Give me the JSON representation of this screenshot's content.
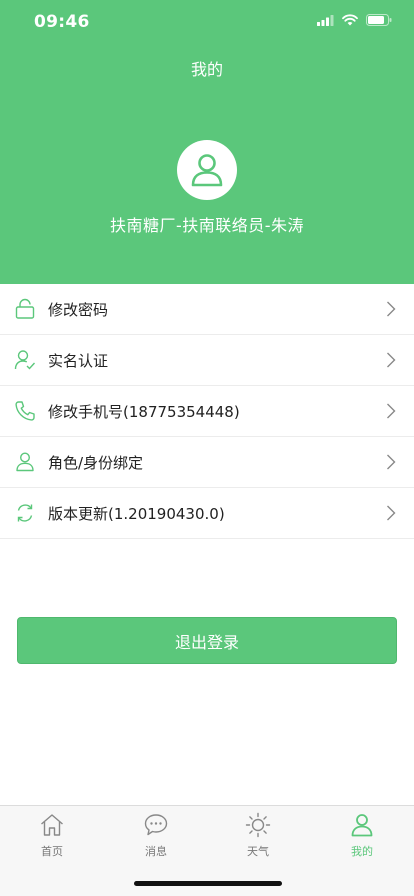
{
  "status": {
    "time": "09:46"
  },
  "header": {
    "title": "我的",
    "user_name": "扶南糖厂-扶南联络员-朱涛"
  },
  "menu": {
    "items": [
      {
        "label": "修改密码",
        "icon": "lock-icon"
      },
      {
        "label": "实名认证",
        "icon": "user-check-icon"
      },
      {
        "label": "修改手机号(18775354448)",
        "icon": "phone-icon"
      },
      {
        "label": "角色/身份绑定",
        "icon": "user-icon"
      },
      {
        "label": "版本更新(1.20190430.0)",
        "icon": "refresh-icon"
      }
    ]
  },
  "logout": {
    "label": "退出登录"
  },
  "tabbar": {
    "active": 3,
    "tabs": [
      {
        "label": "首页",
        "icon": "home-icon"
      },
      {
        "label": "消息",
        "icon": "message-icon"
      },
      {
        "label": "天气",
        "icon": "sun-icon"
      },
      {
        "label": "我的",
        "icon": "profile-icon"
      }
    ]
  },
  "colors": {
    "accent": "#5bc77b",
    "divider": "#ececec",
    "tab_inactive": "#777777"
  }
}
